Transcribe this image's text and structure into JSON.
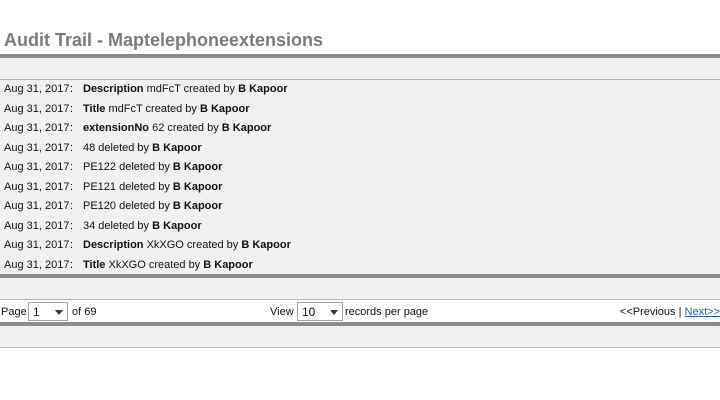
{
  "page": {
    "title": "Audit Trail - Maptelephoneextensions"
  },
  "entries": [
    {
      "date": "Aug 31, 2017",
      "sep": ":",
      "pre": "",
      "bold1": "Description",
      "mid": " mdFcT created by ",
      "user": "B Kapoor"
    },
    {
      "date": "Aug 31, 2017",
      "sep": ":",
      "pre": "",
      "bold1": "Title",
      "mid": " mdFcT created by ",
      "user": "B Kapoor"
    },
    {
      "date": "Aug 31, 2017",
      "sep": ":",
      "pre": "",
      "bold1": "extensionNo",
      "mid": " 62 created by ",
      "user": "B Kapoor"
    },
    {
      "date": "Aug 31, 2017",
      "sep": ":",
      "pre": "48 deleted by ",
      "bold1": "",
      "mid": "",
      "user": "B Kapoor"
    },
    {
      "date": "Aug 31, 2017",
      "sep": ":",
      "pre": "PE122 deleted by ",
      "bold1": "",
      "mid": "",
      "user": "B Kapoor"
    },
    {
      "date": "Aug 31, 2017",
      "sep": ":",
      "pre": "PE121 deleted by ",
      "bold1": "",
      "mid": "",
      "user": "B Kapoor"
    },
    {
      "date": "Aug 31, 2017",
      "sep": ":",
      "pre": "PE120 deleted by ",
      "bold1": "",
      "mid": "",
      "user": "B Kapoor"
    },
    {
      "date": "Aug 31, 2017",
      "sep": ":",
      "pre": "34 deleted by ",
      "bold1": "",
      "mid": "",
      "user": "B Kapoor"
    },
    {
      "date": "Aug 31, 2017",
      "sep": ":",
      "pre": "",
      "bold1": "Description",
      "mid": " XkXGO created by ",
      "user": "B Kapoor"
    },
    {
      "date": "Aug 31, 2017",
      "sep": ":",
      "pre": "",
      "bold1": "Title",
      "mid": " XkXGO created by ",
      "user": "B Kapoor"
    }
  ],
  "pager": {
    "page_label": "Page",
    "page_value": "1",
    "of_label": "of 69",
    "view_label": "View",
    "view_value": "10",
    "records_label": "records per page",
    "prev_label": "<<Previous",
    "divider": "|",
    "next_label": "Next>>"
  },
  "icons": {
    "dropdown": "chevron-down-icon"
  }
}
